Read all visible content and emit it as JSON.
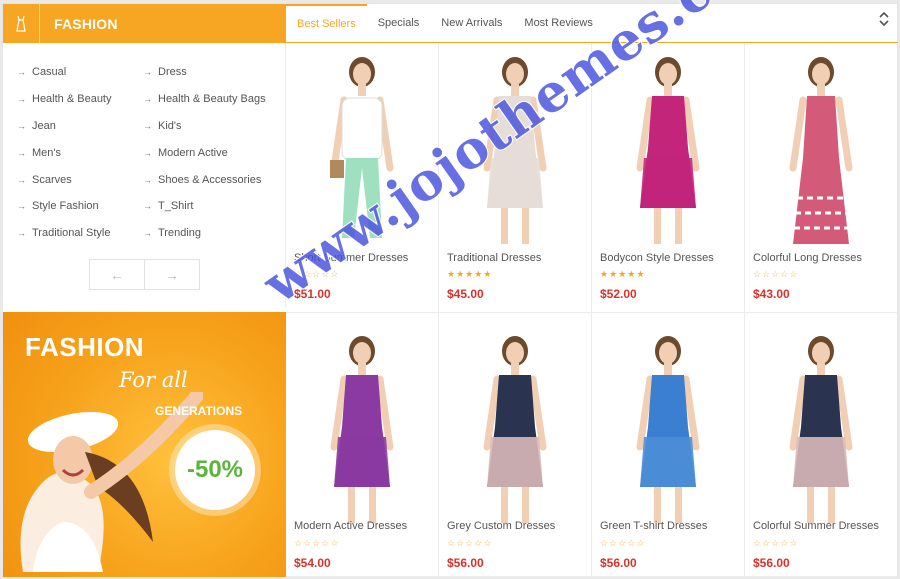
{
  "category": {
    "title": "FASHION",
    "icon": "dress-icon",
    "items": [
      "Casual",
      "Dress",
      "Health & Beauty",
      "Health & Beauty Bags",
      "Jean",
      "Kid's",
      "Men's",
      "Modern Active",
      "Scarves",
      "Shoes & Accessories",
      "Style Fashion",
      "T_Shirt",
      "Traditional Style",
      "Trending"
    ],
    "arrow": "→",
    "prev": "←",
    "next": "→"
  },
  "banner": {
    "title": "FASHION",
    "script": "For all",
    "sub": "GENERATIONS",
    "discount": "-50%"
  },
  "tabs": [
    "Best Sellers",
    "Specials",
    "New Arrivals",
    "Most Reviews"
  ],
  "tab_nav": {
    "up": "⌃",
    "down": "⌄"
  },
  "products": [
    {
      "name": "Short Summer Dresses",
      "rating": 0,
      "price": "$51.00"
    },
    {
      "name": "Traditional Dresses",
      "rating": 5,
      "price": "$45.00"
    },
    {
      "name": "Bodycon Style Dresses",
      "rating": 5,
      "price": "$52.00"
    },
    {
      "name": "Colorful Long Dresses",
      "rating": 0,
      "price": "$43.00"
    },
    {
      "name": "Modern Active Dresses",
      "rating": 0,
      "price": "$54.00"
    },
    {
      "name": "Grey Custom Dresses",
      "rating": 0,
      "price": "$56.00"
    },
    {
      "name": "Green T-shirt Dresses",
      "rating": 0,
      "price": "$56.00"
    },
    {
      "name": "Colorful Summer Dresses",
      "rating": 0,
      "price": "$56.00"
    }
  ],
  "watermark": "www.jojothemes.com",
  "colors": {
    "accent": "#f6a623",
    "price": "#d9322b",
    "discount": "#5ab53a"
  }
}
